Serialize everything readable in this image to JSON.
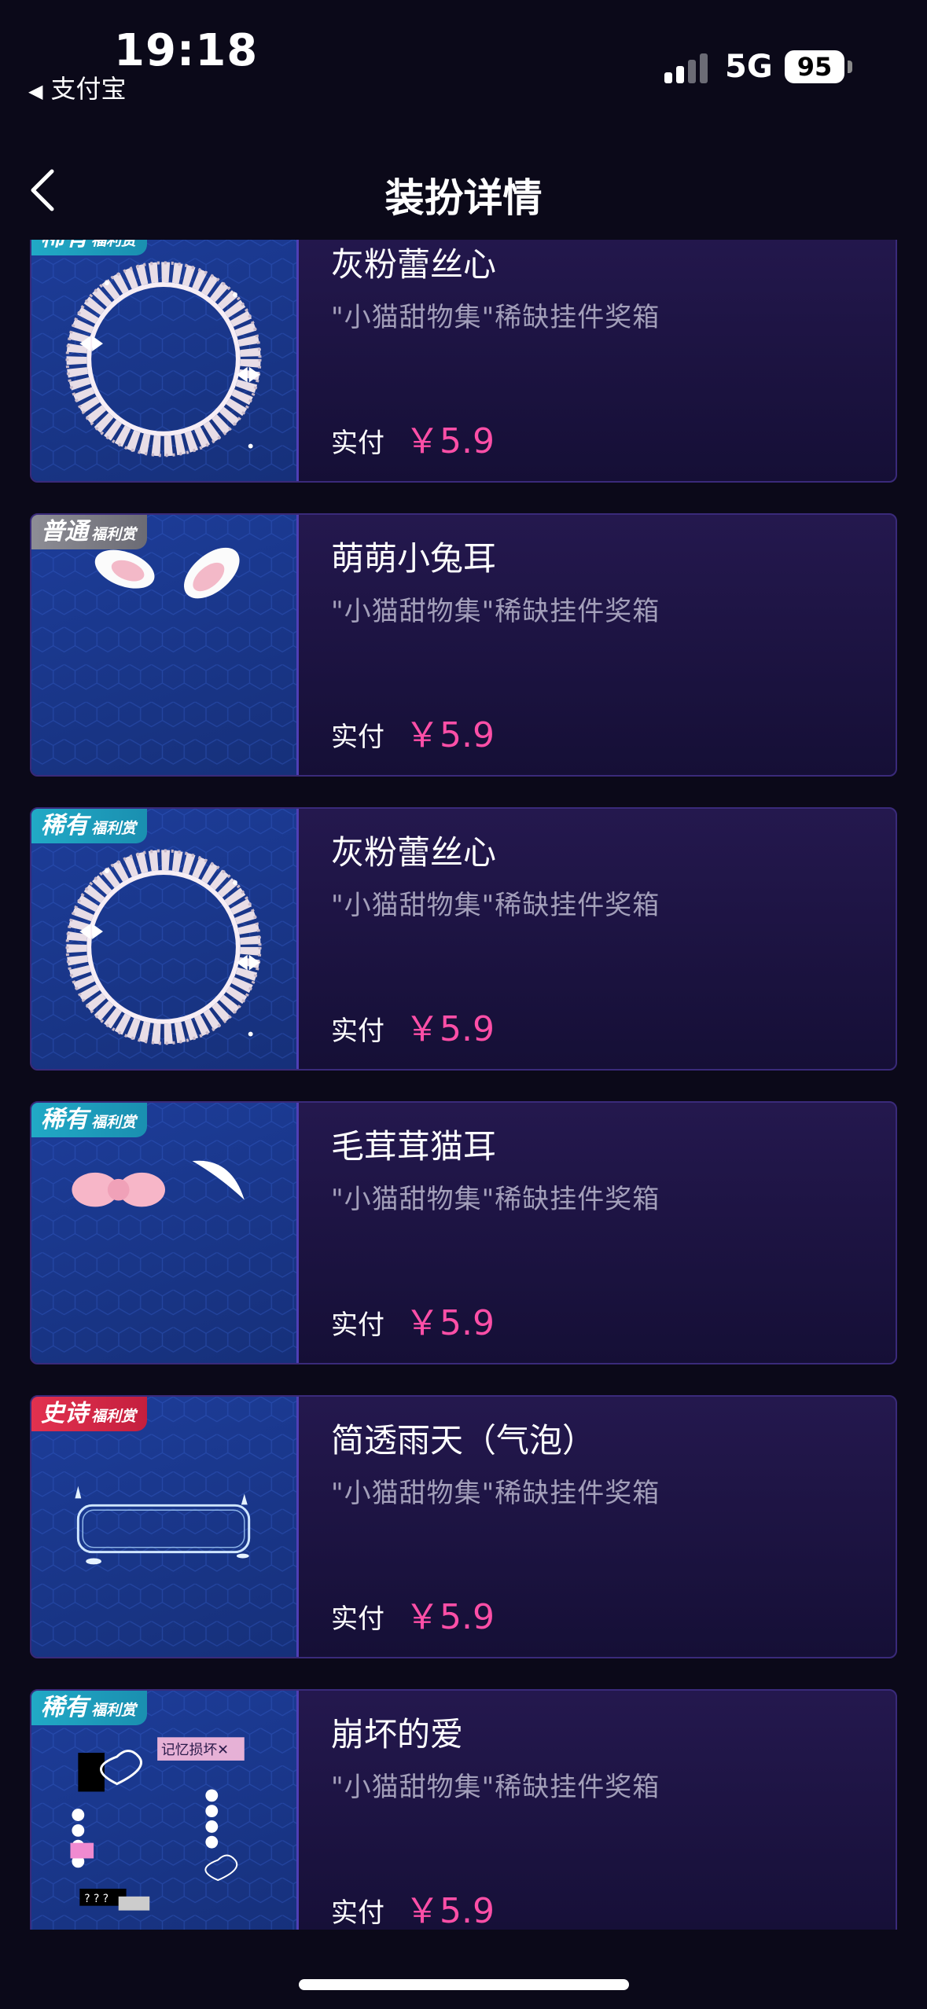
{
  "status_bar": {
    "time": "19:18",
    "back_app": "支付宝",
    "network": "5G",
    "battery": "95"
  },
  "nav": {
    "title": "装扮详情"
  },
  "items": [
    {
      "badge": "稀有",
      "badge_sub": "福利赏",
      "badge_color": "teal",
      "name": "灰粉蕾丝心",
      "subtitle": "\"小猫甜物集\"稀缺挂件奖箱",
      "paid_label": "实付",
      "price": "￥5.9",
      "art": "lace-ring"
    },
    {
      "badge": "普通",
      "badge_sub": "福利赏",
      "badge_color": "gray",
      "name": "萌萌小兔耳",
      "subtitle": "\"小猫甜物集\"稀缺挂件奖箱",
      "paid_label": "实付",
      "price": "￥5.9",
      "art": "bunny-ears"
    },
    {
      "badge": "稀有",
      "badge_sub": "福利赏",
      "badge_color": "teal",
      "name": "灰粉蕾丝心",
      "subtitle": "\"小猫甜物集\"稀缺挂件奖箱",
      "paid_label": "实付",
      "price": "￥5.9",
      "art": "lace-ring"
    },
    {
      "badge": "稀有",
      "badge_sub": "福利赏",
      "badge_color": "teal",
      "name": "毛茸茸猫耳",
      "subtitle": "\"小猫甜物集\"稀缺挂件奖箱",
      "paid_label": "实付",
      "price": "￥5.9",
      "art": "cat-ears"
    },
    {
      "badge": "史诗",
      "badge_sub": "福利赏",
      "badge_color": "red",
      "name": "简透雨天（气泡）",
      "subtitle": "\"小猫甜物集\"稀缺挂件奖箱",
      "paid_label": "实付",
      "price": "￥5.9",
      "art": "bubble"
    },
    {
      "badge": "稀有",
      "badge_sub": "福利赏",
      "badge_color": "teal",
      "name": "崩坏的爱",
      "subtitle": "\"小猫甜物集\"稀缺挂件奖箱",
      "paid_label": "实付",
      "price": "￥5.9",
      "art": "broken-love",
      "art_text": [
        "记忆损坏✕",
        "? ? ?"
      ]
    }
  ]
}
